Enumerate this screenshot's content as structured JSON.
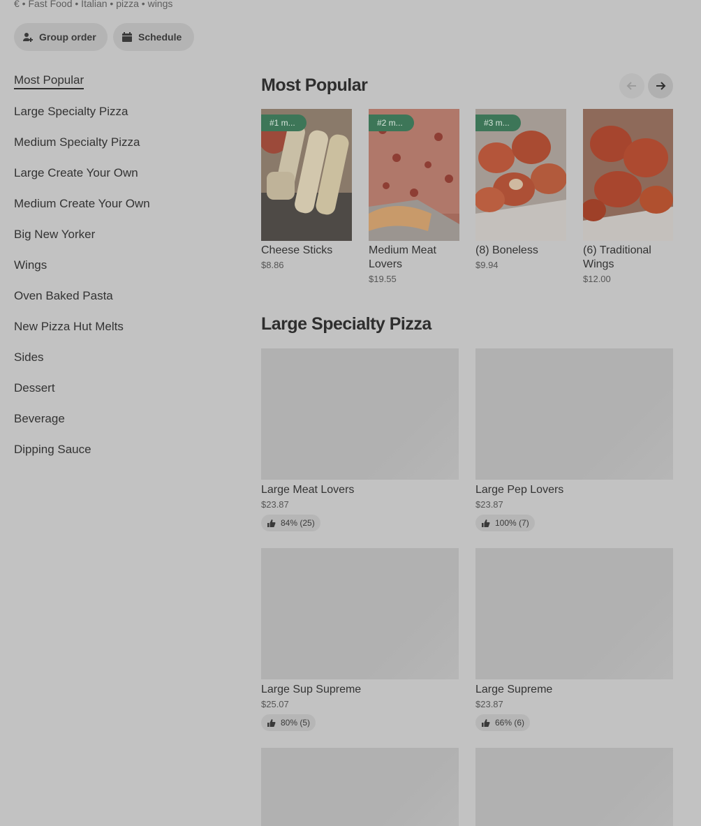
{
  "header": {
    "tags": "€ • Fast Food • Italian • pizza • wings"
  },
  "actions": {
    "group_order": "Group order",
    "schedule": "Schedule"
  },
  "nav": {
    "items": [
      "Most Popular",
      "Large Specialty Pizza",
      "Medium Specialty Pizza",
      "Large Create Your Own",
      "Medium Create Your Own",
      "Big New Yorker",
      "Wings",
      "Oven Baked Pasta",
      "New Pizza Hut Melts",
      "Sides",
      "Dessert",
      "Beverage",
      "Dipping Sauce"
    ],
    "active_index": 0
  },
  "most_popular": {
    "title": "Most Popular",
    "items": [
      {
        "badge": "#1 m...",
        "name": "Cheese Sticks",
        "price": "$8.86"
      },
      {
        "badge": "#2 m...",
        "name": "Medium Meat Lovers",
        "price": "$19.55"
      },
      {
        "badge": "#3 m...",
        "name": "(8) Boneless",
        "price": "$9.94"
      },
      {
        "badge": "",
        "name": "(6) Traditional Wings",
        "price": "$12.00"
      }
    ]
  },
  "large_specialty": {
    "title": "Large Specialty Pizza",
    "items": [
      {
        "name": "Large Meat Lovers",
        "price": "$23.87",
        "rating": "84% (25)"
      },
      {
        "name": "Large Pep Lovers",
        "price": "$23.87",
        "rating": "100% (7)"
      },
      {
        "name": "Large Sup Supreme",
        "price": "$25.07",
        "rating": "80% (5)"
      },
      {
        "name": "Large Supreme",
        "price": "$23.87",
        "rating": "66% (6)"
      }
    ]
  },
  "colors": {
    "background": "#c2c2c2",
    "badge": "#3d7658",
    "chip": "#b4b4b4"
  }
}
